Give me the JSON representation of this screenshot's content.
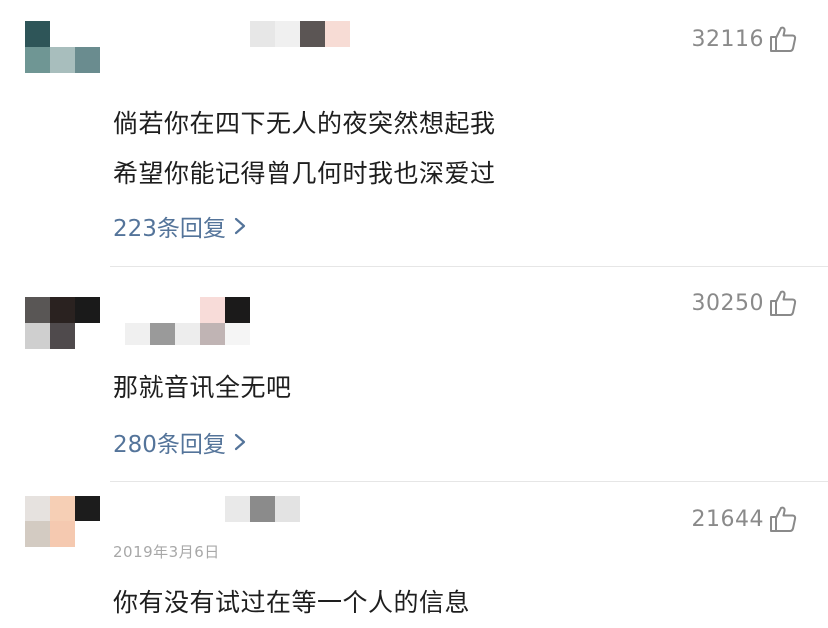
{
  "comments": [
    {
      "likes": "32116",
      "text_lines": [
        "倘若你在四下无人的夜突然想起我",
        "希望你能记得曾几何时我也深爱过"
      ],
      "replies_label": "223条回复",
      "avatar_colors": [
        "#2e5558",
        "#ffffff",
        "#ffffff",
        "#6f9694",
        "#a8bebd",
        "#6a8c8f"
      ],
      "username_colors": [
        "#e7e7e7",
        "#f0f0f0",
        "#5b5554",
        "#f7dcd5"
      ]
    },
    {
      "likes": "30250",
      "text_lines": [
        "那就音讯全无吧"
      ],
      "replies_label": "280条回复",
      "avatar_colors": [
        "#595655",
        "#2a2220",
        "#1a1a1a",
        "#cfcfcf",
        "#4f4a4c",
        "#ffffff"
      ],
      "username_colors": [
        "#f8dcd9",
        "#1b1a1a"
      ],
      "meta_colors": [
        "#f0f0f0",
        "#9a9a9a",
        "#ededed",
        "#c0b4b4",
        "#f5f5f5"
      ]
    },
    {
      "likes": "21644",
      "date": "2019年3月6日",
      "text_lines": [
        "你有没有试过在等一个人的信息"
      ],
      "avatar_colors": [
        "#e6e2df",
        "#f6cfb5",
        "#1c1c1c",
        "#d3cbc2",
        "#f5c9b0",
        "#ffffff"
      ],
      "username_colors": [
        "#e9e9e9",
        "#8b8b8b",
        "#e3e3e3"
      ]
    }
  ]
}
